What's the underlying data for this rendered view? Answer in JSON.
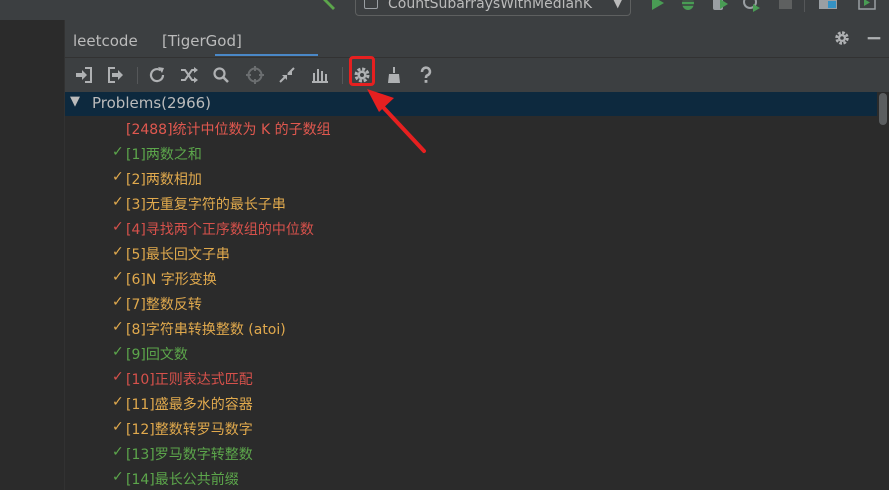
{
  "run_toolbar": {
    "config_label": "CountSubarraysWithMedianK",
    "config_arrow": "▼",
    "icons": [
      "hammer-icon",
      "config-icon",
      "run-icon",
      "debug-icon",
      "coverage-icon",
      "profile-icon",
      "stop-icon",
      "project-structure-icon",
      "run-window-icon"
    ]
  },
  "tool_window": {
    "tabs": [
      "leetcode",
      "[TigerGod]"
    ],
    "active_tab": 1,
    "header_icons": [
      "settings-icon",
      "minimize-icon"
    ]
  },
  "leetcode_toolbar": {
    "buttons": [
      "login-icon",
      "logout-icon",
      "refresh-icon",
      "random-icon",
      "search-icon",
      "locate-icon",
      "collapse-icon",
      "statistics-icon",
      "settings-icon",
      "clear-icon",
      "help-icon"
    ],
    "highlighted_button": "settings-icon"
  },
  "tree": {
    "root_label": "Problems(2966)",
    "root_arrow": "▼",
    "items": [
      {
        "mark": "",
        "title": "[2488]统计中位数为 K 的子数组",
        "status": "current"
      },
      {
        "mark": "✓",
        "title": "[1]两数之和",
        "status": "solved-green"
      },
      {
        "mark": "✓",
        "title": "[2]两数相加",
        "status": "solved-orange"
      },
      {
        "mark": "✓",
        "title": "[3]无重复字符的最长子串",
        "status": "solved-orange"
      },
      {
        "mark": "✓",
        "title": "[4]寻找两个正序数组的中位数",
        "status": "solved-red"
      },
      {
        "mark": "✓",
        "title": "[5]最长回文子串",
        "status": "solved-orange"
      },
      {
        "mark": "✓",
        "title": "[6]N 字形变换",
        "status": "solved-orange"
      },
      {
        "mark": "✓",
        "title": "[7]整数反转",
        "status": "solved-orange"
      },
      {
        "mark": "✓",
        "title": "[8]字符串转换整数 (atoi)",
        "status": "solved-orange"
      },
      {
        "mark": "✓",
        "title": "[9]回文数",
        "status": "solved-green"
      },
      {
        "mark": "✓",
        "title": "[10]正则表达式匹配",
        "status": "solved-red"
      },
      {
        "mark": "✓",
        "title": "[11]盛最多水的容器",
        "status": "solved-orange"
      },
      {
        "mark": "✓",
        "title": "[12]整数转罗马数字",
        "status": "solved-orange"
      },
      {
        "mark": "✓",
        "title": "[13]罗马数字转整数",
        "status": "solved-green"
      },
      {
        "mark": "✓",
        "title": "[14]最长公共前缀",
        "status": "solved-green"
      }
    ]
  },
  "colors": {
    "easy": "#5ca64b",
    "medium": "#e0a94d",
    "hard": "#d6514b",
    "selection": "#0d293e",
    "annotation": "#e62020"
  }
}
